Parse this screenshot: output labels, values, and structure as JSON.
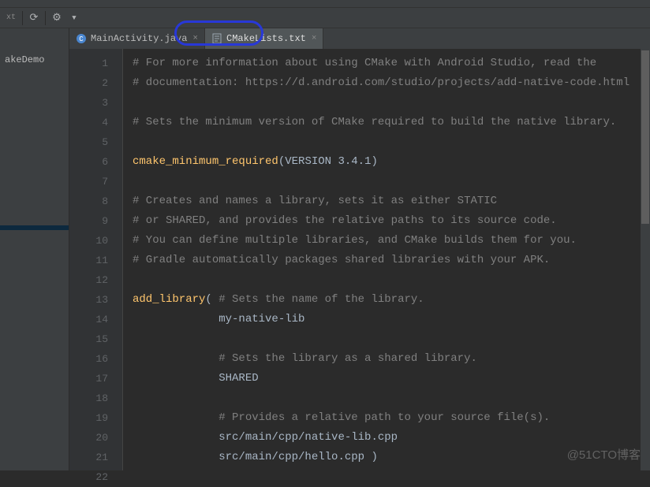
{
  "toolbar": {
    "arrowdown": "▼",
    "gear": "⚙",
    "ext": "xt"
  },
  "project": {
    "item0": "akeDemo",
    "item1_hidden": ""
  },
  "tabs": [
    {
      "label": "MainActivity.java",
      "icon_color": "#4a86cf",
      "icon_letter": "C"
    },
    {
      "label": "CMakeLists.txt",
      "icon_color": "#9aa7b0",
      "icon_letter": ""
    }
  ],
  "gutter_start": 1,
  "gutter_end": 22,
  "code": [
    {
      "t": "comment",
      "text": "# For more information about using CMake with Android Studio, read the"
    },
    {
      "t": "comment",
      "text": "# documentation: https://d.android.com/studio/projects/add-native-code.html"
    },
    {
      "t": "blank",
      "text": ""
    },
    {
      "t": "comment",
      "text": "# Sets the minimum version of CMake required to build the native library."
    },
    {
      "t": "blank",
      "text": ""
    },
    {
      "t": "func",
      "func": "cmake_minimum_required",
      "args": "(VERSION 3.4.1)"
    },
    {
      "t": "blank",
      "text": ""
    },
    {
      "t": "comment",
      "text": "# Creates and names a library, sets it as either STATIC"
    },
    {
      "t": "comment",
      "text": "# or SHARED, and provides the relative paths to its source code."
    },
    {
      "t": "comment",
      "text": "# You can define multiple libraries, and CMake builds them for you."
    },
    {
      "t": "comment",
      "text": "# Gradle automatically packages shared libraries with your APK."
    },
    {
      "t": "blank",
      "text": ""
    },
    {
      "t": "addlib",
      "func": "add_library",
      "open": "( ",
      "comment": "# Sets the name of the library."
    },
    {
      "t": "indent",
      "text": "             my-native-lib"
    },
    {
      "t": "blank",
      "text": ""
    },
    {
      "t": "indentc",
      "text": "             ",
      "comment": "# Sets the library as a shared library."
    },
    {
      "t": "indent",
      "text": "             SHARED"
    },
    {
      "t": "blank",
      "text": ""
    },
    {
      "t": "indentc",
      "text": "             ",
      "comment": "# Provides a relative path to your source file(s)."
    },
    {
      "t": "indent",
      "text": "             src/main/cpp/native-lib.cpp"
    },
    {
      "t": "indent",
      "text": "             src/main/cpp/hello.cpp )"
    },
    {
      "t": "blank",
      "text": ""
    }
  ],
  "watermark": "@51CTO博客"
}
